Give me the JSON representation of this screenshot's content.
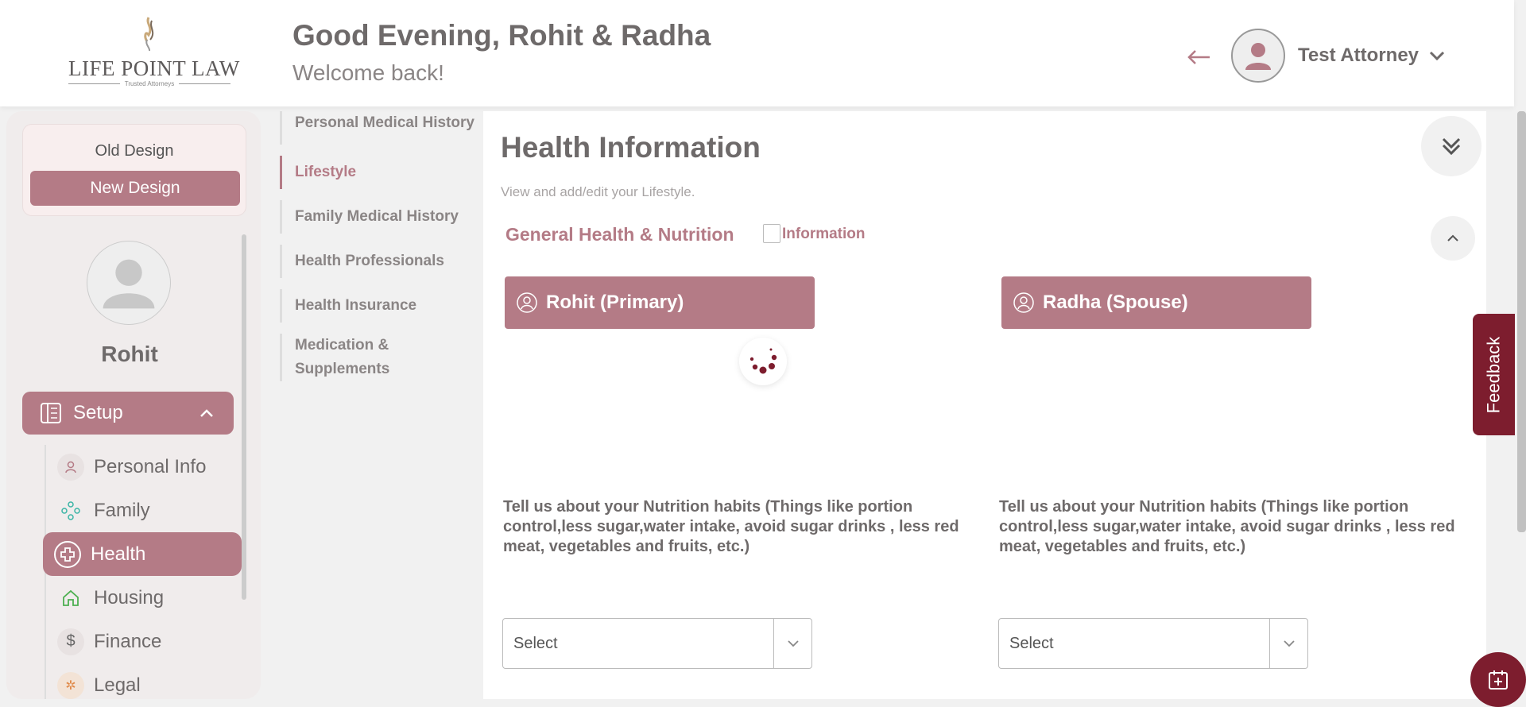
{
  "header": {
    "logo_text": "LIFE POINT LAW",
    "logo_tagline": "Trusted Attorneys",
    "greeting": "Good Evening, Rohit & Radha",
    "welcome": "Welcome back!",
    "user_name": "Test Attorney"
  },
  "sidebar": {
    "old_design": "Old Design",
    "new_design": "New Design",
    "profile_name": "Rohit",
    "setup_label": "Setup",
    "items": [
      {
        "label": "Personal Info",
        "icon": "person-icon"
      },
      {
        "label": "Family",
        "icon": "family-icon"
      },
      {
        "label": "Health",
        "icon": "health-cross-icon"
      },
      {
        "label": "Housing",
        "icon": "house-icon"
      },
      {
        "label": "Finance",
        "icon": "dollar-icon"
      },
      {
        "label": "Legal",
        "icon": "legal-icon"
      }
    ]
  },
  "subnav": {
    "items": [
      {
        "label": "Personal Medical History"
      },
      {
        "label": "Lifestyle"
      },
      {
        "label": "Family Medical History"
      },
      {
        "label": "Health Professionals"
      },
      {
        "label": "Health Insurance"
      },
      {
        "label": "Medication & Supplements"
      }
    ]
  },
  "main": {
    "title": "Health Information",
    "subtitle": "View and add/edit your Lifestyle.",
    "section_title": "General Health & Nutrition",
    "info_alt": "Information",
    "primary_tab": "Rohit (Primary)",
    "spouse_tab": "Radha (Spouse)",
    "question_primary": "Tell us about your Nutrition habits (Things like portion control,less sugar,water intake, avoid sugar drinks , less red meat, vegetables and fruits, etc.)",
    "question_spouse": "Tell us about your Nutrition habits (Things like portion control,less sugar,water intake, avoid sugar drinks , less red meat, vegetables and fruits, etc.)",
    "select_primary": "Select",
    "select_spouse": "Select"
  },
  "feedback_label": "Feedback",
  "colors": {
    "accent": "#b47b86",
    "dark_accent": "#7d1d2e",
    "text": "#6e6a6a"
  }
}
